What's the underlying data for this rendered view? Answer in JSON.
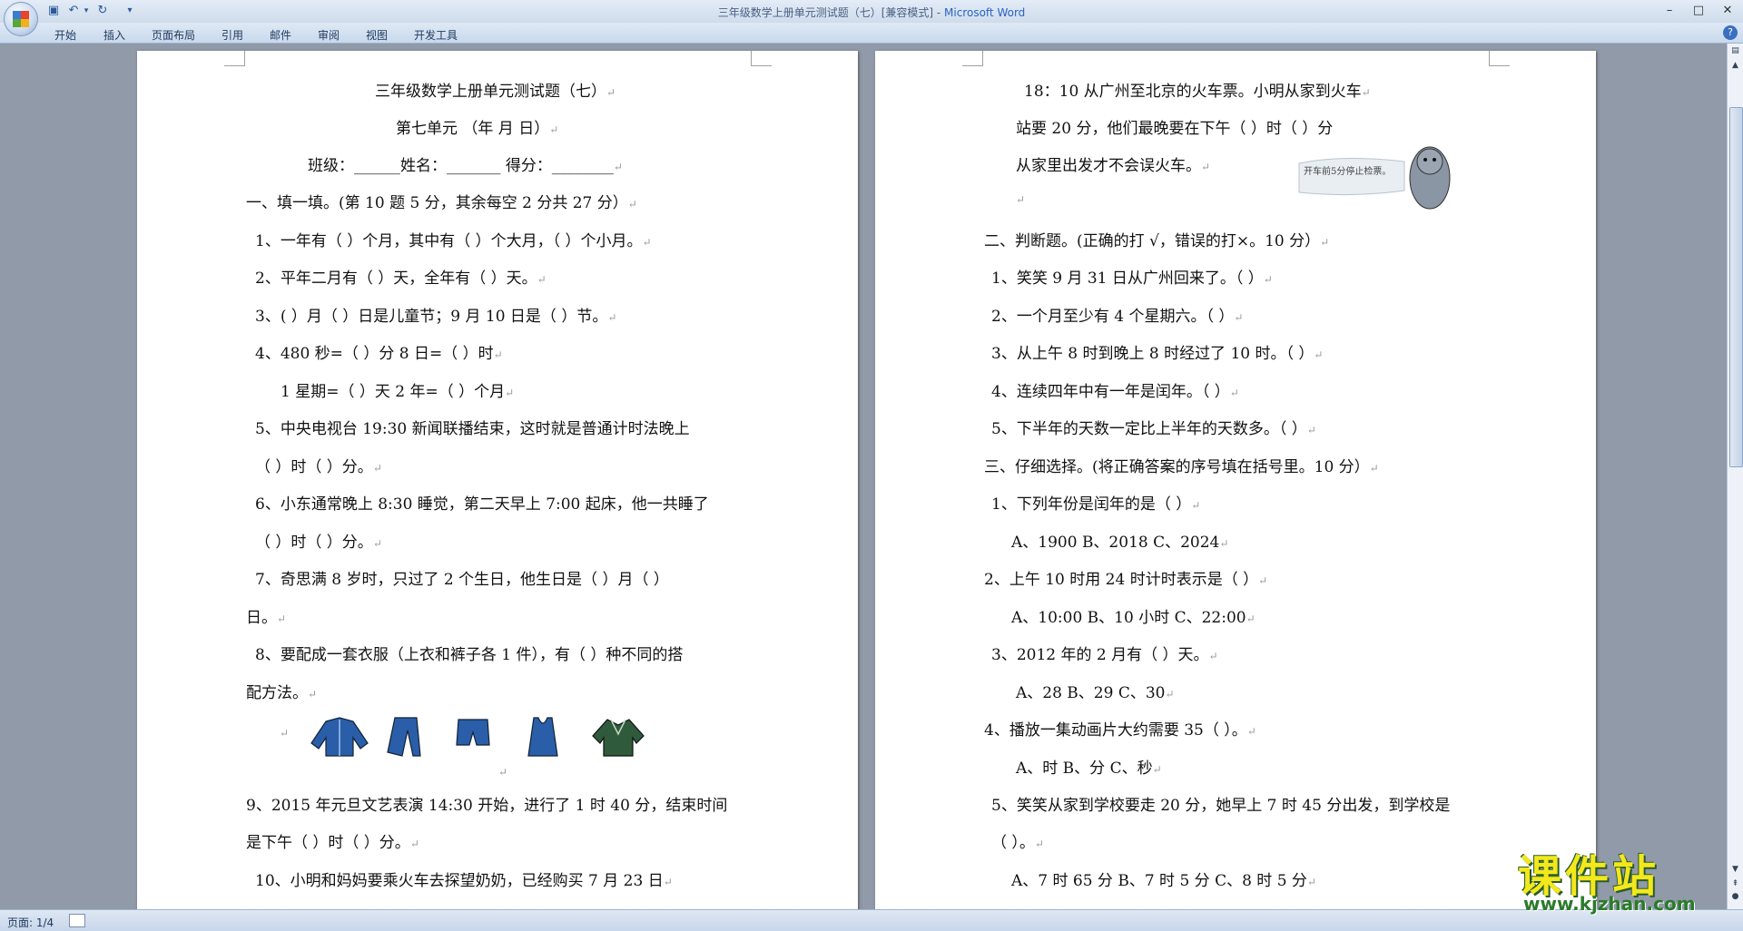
{
  "window": {
    "title": "三年级数学上册单元测试题（七）[兼容模式] - ",
    "app_name": "Microsoft Word",
    "minimize": "–",
    "maximize": "□",
    "close": "✕"
  },
  "qat": {
    "save_icon": "save-icon",
    "undo_icon": "undo-icon",
    "redo_icon": "redo-icon",
    "customize": "▾"
  },
  "ribbon": {
    "tabs": [
      "开始",
      "插入",
      "页面布局",
      "引用",
      "邮件",
      "审阅",
      "视图",
      "开发工具"
    ],
    "help": "?"
  },
  "page1": {
    "lines": [
      "三年级数学上册单元测试题（七）",
      "第七单元      （年  月  日）",
      "班级：______姓名：_______  得分：________",
      "一、填一填。(第 10 题 5 分，其余每空 2 分共 27 分）",
      "1、一年有（      ）个月，其中有（     ）个大月，（     ）个小月。",
      "2、平年二月有（      ）天，全年有（        ）天。",
      "3、(       ）月（       ）日是儿童节；9 月 10 日是（        ）节。",
      "4、480 秒=（      ）分                  8 日=（      ）时",
      "1 星期=（      ）天                2 年=（      ）个月",
      "5、中央电视台 19:30 新闻联播结束，这时就是普通计时法晚上",
      "（        ）时（        ）分。",
      "6、小东通常晚上 8:30 睡觉，第二天早上 7:00 起床，他一共睡了",
      "（        ）时（       ）分。",
      "7、奇思满 8 岁时，只过了 2 个生日，他生日是（         ）月（         ）",
      "日。",
      "8、要配成一套衣服（上衣和裤子各 1 件），有（       ）种不同的搭",
      "配方法。",
      "9、2015 年元旦文艺表演 14:30 开始，进行了 1 时 40 分，结束时间",
      "是下午（      ）时（   ）分。",
      "10、小明和妈妈要乘火车去探望奶奶，已经购买 7 月 23 日"
    ],
    "paragraph_mark": "↵"
  },
  "page2": {
    "lines": [
      "18：10 从广州至北京的火车票。小明从家到火车",
      "站要 20 分，他们最晚要在下午（        ）时（        ）分",
      "从家里出发才不会误火车。",
      "",
      "二、判断题。(正确的打 √，错误的打×。10 分）",
      "1、笑笑 9 月 31 日从广州回来了。（      ）",
      "2、一个月至少有 4 个星期六。（      ）",
      "3、从上午 8 时到晚上 8 时经过了 10 时。（      ）",
      "4、连续四年中有一年是闰年。（      ）",
      "5、下半年的天数一定比上半年的天数多。（      ）",
      "三、仔细选择。(将正确答案的序号填在括号里。10 分）",
      "1、下列年份是闰年的是（      ）",
      "A、1900          B、2018          C、2024",
      "2、上午 10 时用 24 时计时表示是（      ）",
      "A、10:00          B、10 小时          C、22:00",
      "3、2012 年的 2 月有（      ）天。",
      "A、28            B、29            C、30",
      "4、播放一集动画片大约需要 35（         ）。",
      "A、时              B、分            C、秒",
      "5、笑笑从家到学校要走 20 分，她早上 7 时 45 分出发，到学校是",
      "（      ）。",
      "A、7 时 65 分        B、7 时 5 分      C、8 时 5 分"
    ],
    "cartoon_caption": "开车前5分停止检票。"
  },
  "status": {
    "page_count": "页面: 1/4"
  },
  "watermark": {
    "main": "课件站",
    "url": "www.kjzhan.com"
  },
  "colors": {
    "accent": "#1e395b",
    "doc_bg": "#909aa8",
    "title_app": "#2a62c4"
  }
}
